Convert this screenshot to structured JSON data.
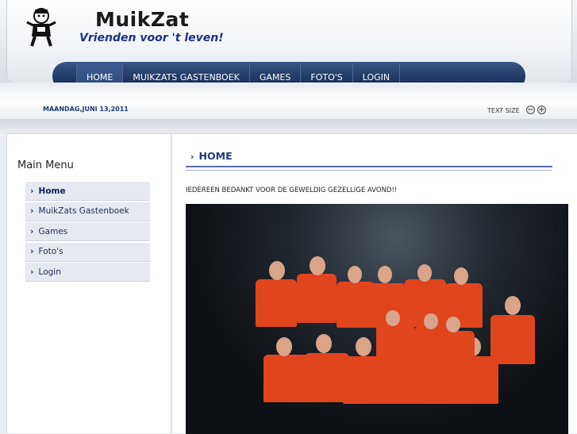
{
  "site": {
    "title": "MuikZat",
    "slogan": "Vrienden voor 't leven!"
  },
  "nav": {
    "items": [
      {
        "label": "HOME",
        "active": true
      },
      {
        "label": "MUIKZATS GASTENBOEK",
        "active": false
      },
      {
        "label": "GAMES",
        "active": false
      },
      {
        "label": "FOTO'S",
        "active": false
      },
      {
        "label": "LOGIN",
        "active": false
      }
    ]
  },
  "toolbar": {
    "date": "MAANDAG,JUNI 13,2011",
    "text_size_label": "TEXT SIZE",
    "decrease_icon": "minus-circle-icon",
    "increase_icon": "plus-circle-icon"
  },
  "sidebar": {
    "title": "Main Menu",
    "items": [
      {
        "label": "Home",
        "active": true
      },
      {
        "label": "MuikZats Gastenboek",
        "active": false
      },
      {
        "label": "Games",
        "active": false
      },
      {
        "label": "Foto's",
        "active": false
      },
      {
        "label": "Login",
        "active": false
      }
    ]
  },
  "main": {
    "heading": "HOME",
    "text": "IEDEREEN BEDANKT VOOR DE GEWELDIG GEZELLIGE AVOND!!"
  },
  "colors": {
    "nav_bg": "#233c69",
    "accent": "#1e3b7e",
    "shirt": "#e1451e"
  }
}
